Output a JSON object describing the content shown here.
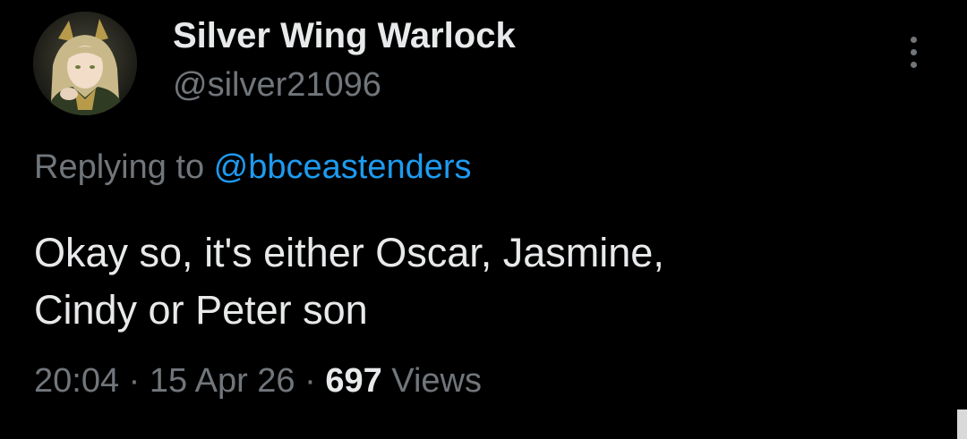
{
  "user": {
    "display_name": "Silver Wing Warlock",
    "handle": "@silver21096",
    "avatar_icon": "avatar-image"
  },
  "reply": {
    "prefix": "Replying to ",
    "mention": "@bbceastenders"
  },
  "tweet": {
    "text": "Okay so, it's either Oscar, Jasmine,\nCindy or Peter son"
  },
  "meta": {
    "time": "20:04",
    "separator": " · ",
    "date": "15 Apr 26",
    "views_count": "697",
    "views_label": " Views"
  },
  "menu": {
    "icon": "more-vertical-icon"
  },
  "colors": {
    "background": "#000000",
    "primary_text": "#e7e9ea",
    "secondary_text": "#71767b",
    "accent": "#1d9bf0"
  }
}
